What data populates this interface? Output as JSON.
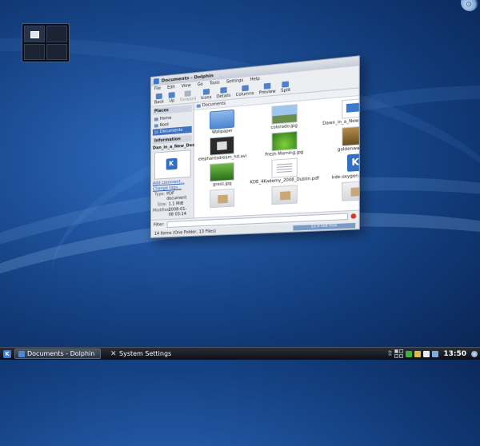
{
  "window": {
    "title": "Documents - Dolphin",
    "menu": [
      "File",
      "Edit",
      "View",
      "Go",
      "Tools",
      "Settings",
      "Help"
    ],
    "toolbar": [
      {
        "label": "Back",
        "dim": false
      },
      {
        "label": "Up",
        "dim": false
      },
      {
        "label": "Forward",
        "dim": true
      },
      {
        "label": "Icons",
        "dim": false
      },
      {
        "label": "Details",
        "dim": false
      },
      {
        "label": "Columns",
        "dim": false
      },
      {
        "label": "Preview",
        "dim": false
      },
      {
        "label": "Split",
        "dim": false
      }
    ],
    "places_header": "Places",
    "places": [
      "Home",
      "Root",
      "Documents"
    ],
    "places_selected": 2,
    "info_header": "Information",
    "info_filename": "Dan_in_a_New_Desktop",
    "info_links": [
      "Add comment...",
      "Change tags..."
    ],
    "info_fields": [
      {
        "k": "Type:",
        "v": "PDF document"
      },
      {
        "k": "Size:",
        "v": "1.1 MiB"
      },
      {
        "k": "Modified:",
        "v": "2008-01-08 03:14"
      }
    ],
    "breadcrumb": "Documents",
    "files": [
      {
        "name": "Wallpaper",
        "kind": "folder"
      },
      {
        "name": "colorado.jpg",
        "kind": "sky"
      },
      {
        "name": "Dawn_in_a_New_Desktop.pdf",
        "kind": "doc"
      },
      {
        "name": "elephantsdream_hd.avi",
        "kind": "film"
      },
      {
        "name": "Fresh Morning.jpg",
        "kind": "green"
      },
      {
        "name": "goldenwave.jpg",
        "kind": "brown"
      },
      {
        "name": "grass.jpg",
        "kind": "grass"
      },
      {
        "name": "KDE_4Kademy_2008_Dublin.pdf",
        "kind": "pdf"
      },
      {
        "name": "kde-oxygen-logo.svg",
        "kind": "kde"
      },
      {
        "name": "",
        "kind": "box"
      },
      {
        "name": "",
        "kind": "box"
      },
      {
        "name": "",
        "kind": "box"
      }
    ],
    "filter_label": "Filter:",
    "status": "14 Items (One Folder, 13 Files)",
    "free_space": "12.9 GiB free"
  },
  "taskbar": {
    "tasks": [
      {
        "label": "Documents - Dolphin",
        "active": true
      },
      {
        "label": "System Settings",
        "active": false
      }
    ],
    "clock": "13:50",
    "tray_colors": [
      "#3fae3a",
      "#d9b94a",
      "#e7ecf2",
      "#7fa8de"
    ]
  },
  "pager": {
    "desktops": 4,
    "active": 0
  }
}
